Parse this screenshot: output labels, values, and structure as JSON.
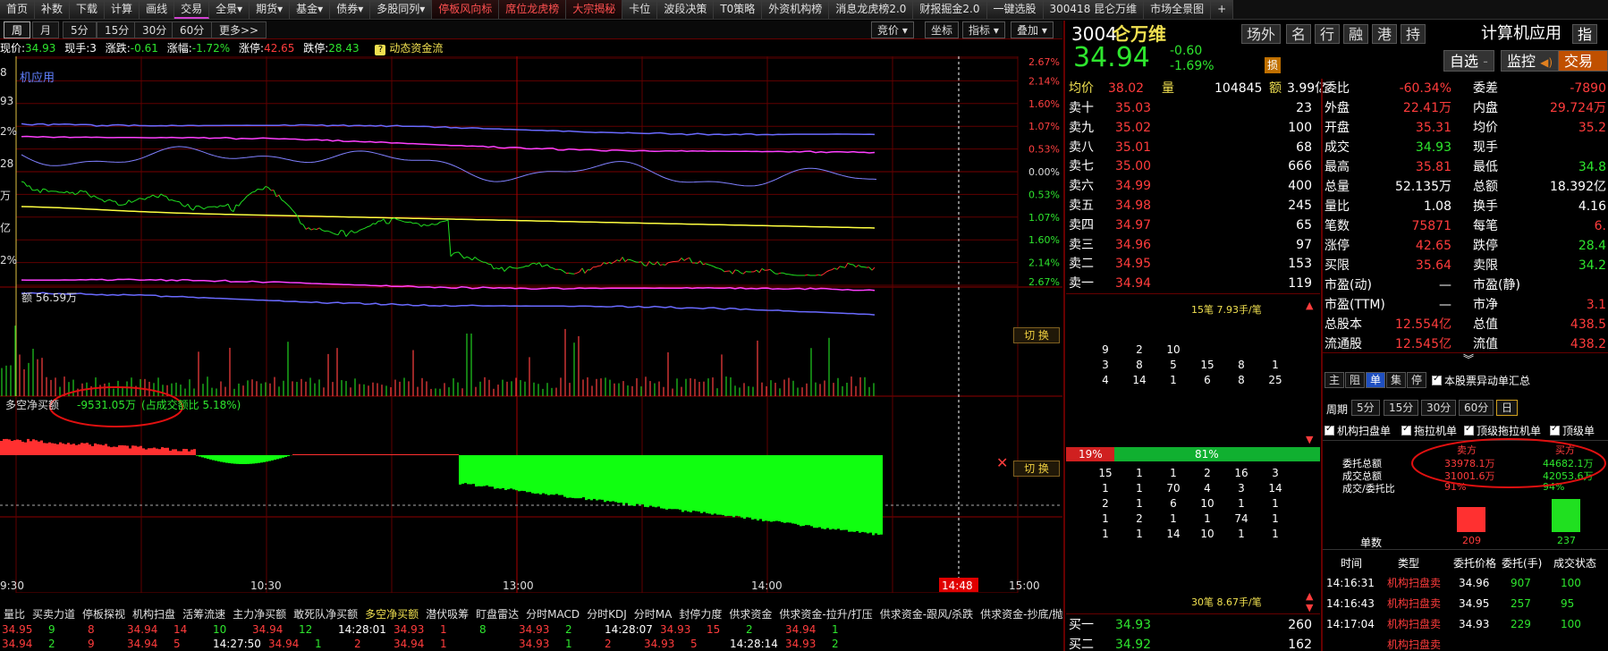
{
  "topnav": [
    {
      "label": "首页",
      "red": false
    },
    {
      "label": "补数",
      "red": false
    },
    {
      "label": "下载",
      "red": false
    },
    {
      "label": "计算",
      "red": false
    },
    {
      "label": "画线",
      "red": false
    },
    {
      "label": "交易",
      "red": false
    },
    {
      "label": "全景▾",
      "red": false
    },
    {
      "label": "期货▾",
      "red": false
    },
    {
      "label": "基金▾",
      "red": false
    },
    {
      "label": "债券▾",
      "red": false
    },
    {
      "label": "多股同列▾",
      "red": false
    },
    {
      "label": "停板风向标",
      "red": true
    },
    {
      "label": "席位龙虎榜",
      "red": true
    },
    {
      "label": "大宗揭秘",
      "red": true
    },
    {
      "label": "卡位",
      "red": false
    },
    {
      "label": "波段决策",
      "red": false
    },
    {
      "label": "T0策略",
      "red": false
    },
    {
      "label": "外资机构榜",
      "red": false
    },
    {
      "label": "消息龙虎榜2.0",
      "red": false
    },
    {
      "label": "财报掘金2.0",
      "red": false
    },
    {
      "label": "一键选股",
      "red": false
    },
    {
      "label": "300418 昆仑万维",
      "red": false
    },
    {
      "label": "市场全景图",
      "red": false
    },
    {
      "label": "+",
      "red": false
    }
  ],
  "periods": [
    "周",
    "月",
    "5分",
    "15分",
    "30分",
    "60分",
    "更多>>"
  ],
  "chart_tools": [
    "竞价 ▾",
    "坐标",
    "指标 ▾",
    "叠加 ▾"
  ],
  "info": {
    "price_label": "现价:",
    "price": "34.93",
    "vol_label": "现手:",
    "vol": "3",
    "chg_label": "涨跌:",
    "chg": "-0.61",
    "pct_label": "涨幅:",
    "pct": "-1.72%",
    "up_label": "涨停:",
    "up": "42.65",
    "down_label": "跌停:",
    "down": "28.43",
    "flow": "动态资金流"
  },
  "chart": {
    "overlay_label": "机应用",
    "pct_ticks": [
      "2.67%",
      "2.14%",
      "1.60%",
      "1.07%",
      "0.53%",
      "0.00%",
      "0.53%",
      "1.07%",
      "1.60%",
      "2.14%",
      "2.67%"
    ],
    "left_edge_labels": [
      "8",
      "93",
      "2%",
      "28",
      "万",
      "亿",
      "2%"
    ],
    "vol_label": "额 56.59万",
    "net_label": "多空净买额",
    "net_value": "-9531.05万",
    "net_ratio": "(占成交额比 5.18%)",
    "switch": "切 换",
    "time_ticks": [
      "9:30",
      "10:30",
      "13:00",
      "14:00",
      "15:00"
    ],
    "cursor_time": "14:48"
  },
  "stock": {
    "code": "3004",
    "name": "昆仑万维",
    "name_visible": "仑万维",
    "tags": [
      "场外",
      "名",
      "行",
      "融",
      "港",
      "持"
    ],
    "price": "34.94",
    "change": "-0.60",
    "change_pct": "-1.69%",
    "hint": "损",
    "sector": "计算机应用",
    "index_btn": "指",
    "watch": "自选",
    "monitor": "监控",
    "trade": "交易"
  },
  "orderbook": {
    "avg_label": "均价",
    "avg": "38.02",
    "vol_label": "量",
    "vol": "104845",
    "amt_label": "额",
    "amt": "3.99亿",
    "asks": [
      {
        "label": "卖十",
        "price": "35.03",
        "vol": "23"
      },
      {
        "label": "卖九",
        "price": "35.02",
        "vol": "100"
      },
      {
        "label": "卖八",
        "price": "35.01",
        "vol": "68"
      },
      {
        "label": "卖七",
        "price": "35.00",
        "vol": "666"
      },
      {
        "label": "卖六",
        "price": "34.99",
        "vol": "400"
      },
      {
        "label": "卖五",
        "price": "34.98",
        "vol": "245"
      },
      {
        "label": "卖四",
        "price": "34.97",
        "vol": "65"
      },
      {
        "label": "卖三",
        "price": "34.96",
        "vol": "97"
      },
      {
        "label": "卖二",
        "price": "34.95",
        "vol": "153"
      },
      {
        "label": "卖一",
        "price": "34.94",
        "vol": "119"
      }
    ],
    "bids": [
      {
        "label": "买一",
        "price": "34.93",
        "vol": "260"
      },
      {
        "label": "买二",
        "price": "34.92",
        "vol": "162"
      }
    ],
    "top_summary": "15笔 7.93手/笔",
    "bottom_summary": "30笔 8.67手/笔",
    "ask_queue": [
      [
        "9",
        "2",
        "10",
        "",
        "",
        ""
      ],
      [
        "3",
        "8",
        "5",
        "15",
        "8",
        "1"
      ],
      [
        "4",
        "14",
        "1",
        "6",
        "8",
        "25"
      ]
    ],
    "sell_pct": "19%",
    "buy_pct": "81%",
    "sell_fraction": 0.19,
    "bid_queue": [
      [
        "15",
        "1",
        "1",
        "2",
        "16",
        "3"
      ],
      [
        "1",
        "1",
        "70",
        "4",
        "3",
        "14"
      ],
      [
        "2",
        "1",
        "6",
        "10",
        "1",
        "1"
      ],
      [
        "1",
        "2",
        "1",
        "1",
        "74",
        "1"
      ],
      [
        "1",
        "1",
        "14",
        "10",
        "1",
        "1"
      ]
    ]
  },
  "stats": [
    {
      "l1": "委比",
      "v1": "-60.34%",
      "c1": "red",
      "l2": "委差",
      "v2": "-7890",
      "c2": "red"
    },
    {
      "l1": "外盘",
      "v1": "22.41万",
      "c1": "red",
      "l2": "内盘",
      "v2": "29.724万",
      "c2": "red"
    },
    {
      "l1": "开盘",
      "v1": "35.31",
      "c1": "red",
      "l2": "均价",
      "v2": "35.2",
      "c2": "red"
    },
    {
      "l1": "成交",
      "v1": "34.93",
      "c1": "green",
      "l2": "现手",
      "v2": "",
      "c2": "white"
    },
    {
      "l1": "最高",
      "v1": "35.81",
      "c1": "red",
      "l2": "最低",
      "v2": "34.8",
      "c2": "green"
    },
    {
      "l1": "总量",
      "v1": "52.135万",
      "c1": "white",
      "l2": "总额",
      "v2": "18.392亿",
      "c2": "white"
    },
    {
      "l1": "量比",
      "v1": "1.08",
      "c1": "white",
      "l2": "换手",
      "v2": "4.16",
      "c2": "white"
    },
    {
      "l1": "笔数",
      "v1": "75871",
      "c1": "red",
      "l2": "每笔",
      "v2": "6.",
      "c2": "red"
    },
    {
      "l1": "涨停",
      "v1": "42.65",
      "c1": "red",
      "l2": "跌停",
      "v2": "28.4",
      "c2": "green"
    },
    {
      "l1": "买限",
      "v1": "35.64",
      "c1": "red",
      "l2": "卖限",
      "v2": "34.2",
      "c2": "green"
    },
    {
      "l1": "市盈(动)",
      "v1": "—",
      "c1": "white",
      "l2": "市盈(静)",
      "v2": "",
      "c2": "white"
    },
    {
      "l1": "市盈(TTM)",
      "v1": "—",
      "c1": "white",
      "l2": "市净",
      "v2": "3.1",
      "c2": "red"
    },
    {
      "l1": "总股本",
      "v1": "12.554亿",
      "c1": "red",
      "l2": "总值",
      "v2": "438.5",
      "c2": "red"
    },
    {
      "l1": "流通股",
      "v1": "12.545亿",
      "c1": "red",
      "l2": "流值",
      "v2": "438.2",
      "c2": "red"
    }
  ],
  "orders": {
    "tabs": [
      "主",
      "阻",
      "单",
      "集",
      "停"
    ],
    "checkbox_label": "本股票异动单汇总",
    "period_label": "周期",
    "periods": [
      "5分",
      "15分",
      "30分",
      "60分",
      "日"
    ],
    "filters": [
      "机构扫盘单",
      "拖拉机单",
      "顶级拖拉机单",
      "顶级单"
    ],
    "sell_head": "卖方",
    "buy_head": "买方",
    "rows": [
      {
        "label": "委托总额",
        "sell": "33978.1万",
        "buy": "44682.1万"
      },
      {
        "label": "成交总额",
        "sell": "31001.6万",
        "buy": "42053.6万"
      },
      {
        "label": "成交/委托比",
        "sell": "91%",
        "buy": "94%"
      }
    ],
    "count_label": "单数",
    "sell_count": "209",
    "buy_count": "237",
    "table_headers": [
      "时间",
      "类型",
      "委托价格",
      "委托(手)",
      "成交状态"
    ],
    "table": [
      {
        "time": "14:16:31",
        "type": "机构扫盘卖",
        "price": "34.96",
        "qty": "907",
        "status": "100"
      },
      {
        "time": "14:16:43",
        "type": "机构扫盘卖",
        "price": "34.95",
        "qty": "257",
        "status": "95"
      },
      {
        "time": "14:17:04",
        "type": "机构扫盘卖",
        "price": "34.93",
        "qty": "229",
        "status": "100"
      },
      {
        "time": "",
        "type": "机构扫盘卖",
        "price": "",
        "qty": "",
        "status": ""
      }
    ]
  },
  "bottom_tabs": [
    "量比",
    "买卖力道",
    "停板探视",
    "机构扫盘",
    "活筹流速",
    "主力净买额",
    "敢死队净买额",
    "多空净买额",
    "潜伏吸筹",
    "盯盘雷达",
    "分时MACD",
    "分时KDJ",
    "分时MA",
    "封停力度",
    "供求资金",
    "供求资金-拉升/打压",
    "供求资金-跟风/杀跌",
    "供求资金-抄底/抛压"
  ],
  "ticker": [
    [
      "34.95",
      "9",
      "8",
      "34.94",
      "14",
      "10",
      "34.94",
      "12",
      "14:28:01",
      "34.93",
      "1",
      "8",
      "34.93",
      "2",
      "14:28:07",
      "34.93",
      "15",
      "2",
      "34.94",
      "1"
    ],
    [
      "34.94",
      "2",
      "9",
      "34.94",
      "5",
      "14:27:50",
      "34.94",
      "1",
      "2",
      "34.94",
      "1",
      "",
      "34.93",
      "1",
      "2",
      "34.93",
      "5",
      "14:28:14",
      "34.93",
      "2"
    ]
  ]
}
